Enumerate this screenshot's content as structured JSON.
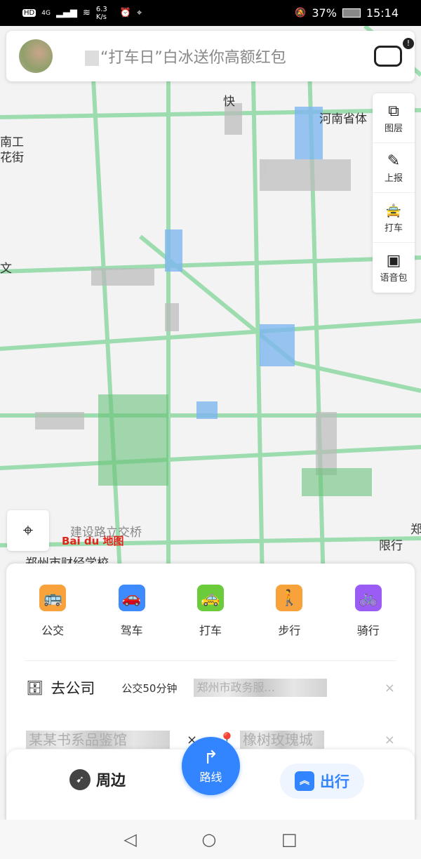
{
  "status": {
    "left_icons": [
      "HD",
      "4G",
      "signal-icon",
      "wifi-icon"
    ],
    "net_speed": "6.3 K/s",
    "alarm": "⏰",
    "location": "⌖",
    "mute": "🔕",
    "battery": "37%",
    "time": "15:14"
  },
  "search": {
    "placeholder": "“打车日”白冰送你高额红包",
    "badge": "!"
  },
  "tools": [
    {
      "icon": "layers-icon",
      "glyph": "⧉",
      "label": "图层"
    },
    {
      "icon": "report-icon",
      "glyph": "✎",
      "label": "上报"
    },
    {
      "icon": "taxi-icon",
      "glyph": "🚖",
      "label": "打车"
    },
    {
      "icon": "voice-pack-icon",
      "glyph": "▣",
      "label": "语音包"
    }
  ],
  "map_labels": {
    "l1": "快",
    "l2": "河南省体",
    "l3": "南工",
    "l4": "花街",
    "l5": "文",
    "l6": "建设路立交桥",
    "l7": "郑州市财经学校",
    "l8": "限行",
    "l9": "郑",
    "logo": "Bai du 地图"
  },
  "modes": [
    {
      "label": "公交",
      "color": "#f7a23b",
      "glyph": "🚌"
    },
    {
      "label": "驾车",
      "color": "#3e8bff",
      "glyph": "🚗"
    },
    {
      "label": "打车",
      "color": "#6bcb3b",
      "glyph": "🚕"
    },
    {
      "label": "步行",
      "color": "#f7a23b",
      "glyph": "🚶"
    },
    {
      "label": "骑行",
      "color": "#9a5cf5",
      "glyph": "🚲"
    }
  ],
  "commute": {
    "title": "去公司",
    "eta": "公交50分钟",
    "destination": "郑州市政务服..."
  },
  "recent": {
    "from": "某某书系品鉴馆",
    "to": "橡树玫瑰城"
  },
  "bottom": {
    "nearby": "周边",
    "route": "路线",
    "travel": "出行"
  },
  "nav": {
    "back": "◁",
    "home": "○",
    "recent": "□"
  }
}
